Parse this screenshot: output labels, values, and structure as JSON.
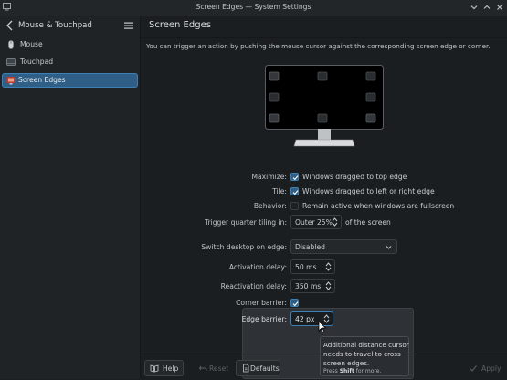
{
  "window": {
    "title": "Screen Edges — System Settings",
    "controls": [
      "chevron-down-icon",
      "chevron-up-icon",
      "close-icon"
    ]
  },
  "sidebar": {
    "title": "Mouse & Touchpad",
    "items": [
      {
        "label": "Mouse",
        "icon": "mouse-icon",
        "selected": false
      },
      {
        "label": "Touchpad",
        "icon": "touchpad-icon",
        "selected": false
      },
      {
        "label": "Screen Edges",
        "icon": "screen-edges-icon",
        "selected": true
      }
    ]
  },
  "page": {
    "title": "Screen Edges",
    "description": "You can trigger an action by pushing the mouse cursor against the corresponding screen edge or corner."
  },
  "form": {
    "maximize_label": "Maximize:",
    "maximize_text": "Windows dragged to top edge",
    "maximize_checked": true,
    "tile_label": "Tile:",
    "tile_text": "Windows dragged to left or right edge",
    "tile_checked": true,
    "behavior_label": "Behavior:",
    "behavior_text": "Remain active when windows are fullscreen",
    "behavior_checked": false,
    "quarter_label": "Trigger quarter tiling in:",
    "quarter_value": "Outer 25%",
    "quarter_suffix": "of the screen",
    "switch_label": "Switch desktop on edge:",
    "switch_value": "Disabled",
    "activation_label": "Activation delay:",
    "activation_value": "50 ms",
    "reactivation_label": "Reactivation delay:",
    "reactivation_value": "350 ms",
    "corner_label": "Corner barrier:",
    "corner_checked": true,
    "edge_label": "Edge barrier:",
    "edge_value": "42 px"
  },
  "tooltip": {
    "line1": "Additional distance cursor",
    "line2": "needs to travel to cross",
    "line3": "screen edges.",
    "more_prefix": "Press ",
    "more_key": "Shift",
    "more_suffix": " for more."
  },
  "buttons": {
    "help": "Help",
    "reset": "Reset",
    "defaults": "Defaults",
    "apply": "Apply"
  },
  "colors": {
    "accent": "#3d80b5",
    "selection": "#2f5f86",
    "background": "#1b1e20",
    "sidebar": "#202326"
  }
}
